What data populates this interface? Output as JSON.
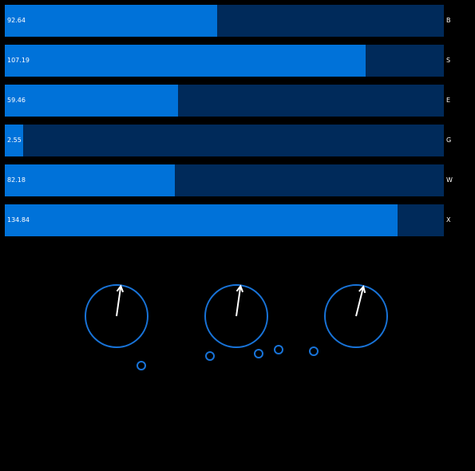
{
  "theme": {
    "background": "#000000",
    "track_color": "#002a5a",
    "fill_color": "#0072d9",
    "text_color": "#ffffff",
    "dial_stroke": "#1873d8",
    "needle_color": "#ffffff"
  },
  "bars": [
    {
      "value": "92.64",
      "label": "B",
      "level": 0.484
    },
    {
      "value": "107.19",
      "label": "S",
      "level": 0.822
    },
    {
      "value": "59.46",
      "label": "E",
      "level": 0.395
    },
    {
      "value": "2.55",
      "label": "G",
      "level": 0.042
    },
    {
      "value": "82.18",
      "label": "W",
      "level": 0.387
    },
    {
      "value": "134.84",
      "label": "X",
      "level": 0.895
    }
  ],
  "knobs": [
    {
      "name": "knob-1",
      "angle_deg": 8
    },
    {
      "name": "knob-2",
      "angle_deg": 8
    },
    {
      "name": "knob-3",
      "angle_deg": 14
    }
  ]
}
